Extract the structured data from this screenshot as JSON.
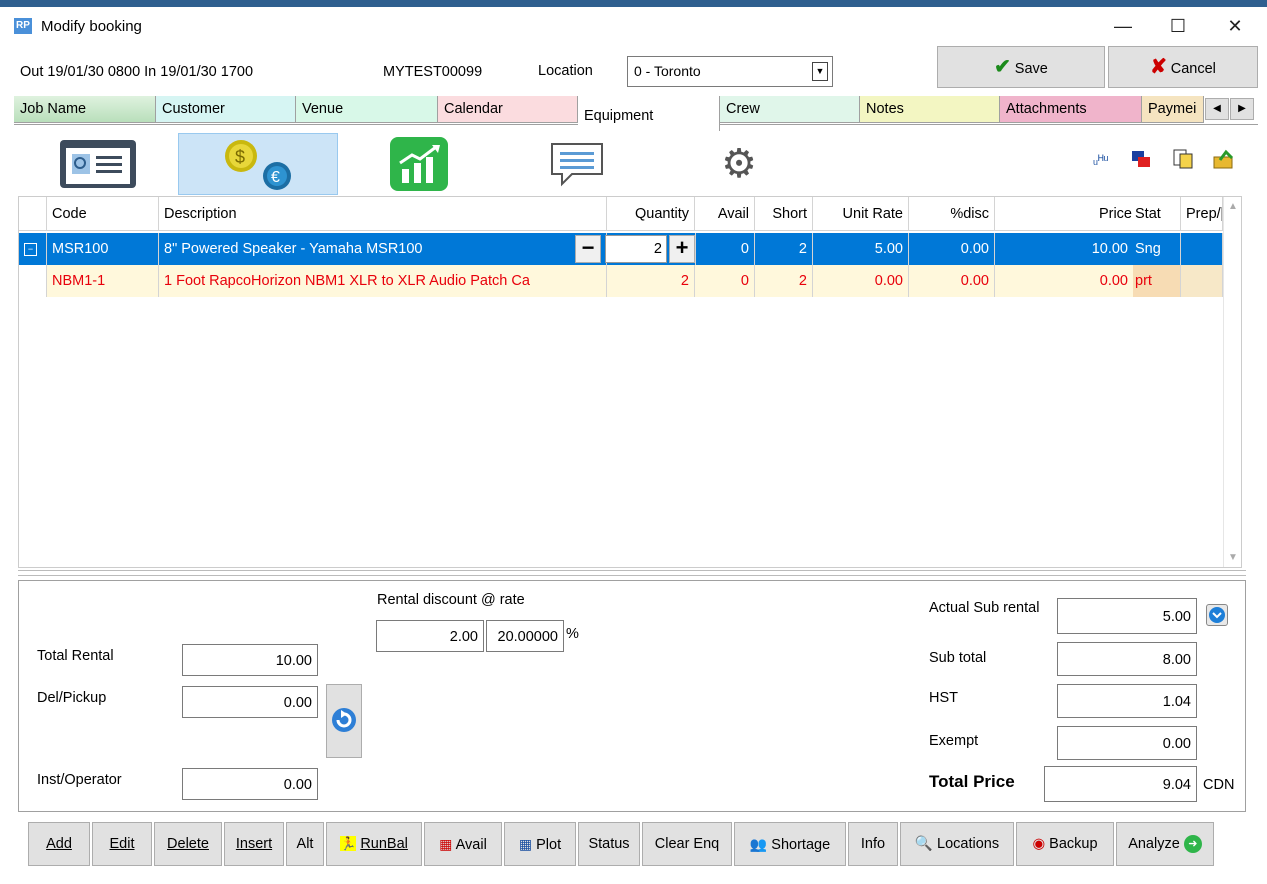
{
  "window": {
    "title": "Modify booking",
    "app_icon": "RP",
    "minimize": "—",
    "maximize": "☐",
    "close": "✕"
  },
  "info": {
    "dates": "Out 19/01/30 0800  In 19/01/30 1700",
    "booking_no": "MYTEST00099",
    "location_label": "Location",
    "location_value": "0 - Toronto",
    "save_label": "Save",
    "cancel_label": "Cancel"
  },
  "tabs": [
    {
      "label": "Job Name",
      "color": "#c8e6c9"
    },
    {
      "label": "Customer",
      "color": "#d6f5f3"
    },
    {
      "label": "Venue",
      "color": "#d8f8e8"
    },
    {
      "label": "Calendar",
      "color": "#fbdcdf"
    },
    {
      "label": "Equipment",
      "color": "#ffffff"
    },
    {
      "label": "Crew",
      "color": "#e0f6ea"
    },
    {
      "label": "Notes",
      "color": "#f3f6c2"
    },
    {
      "label": "Attachments",
      "color": "#f0b4cb"
    },
    {
      "label": "Paymei",
      "color": "#f5e4c0"
    }
  ],
  "grid": {
    "headers": {
      "code": "Code",
      "description": "Description",
      "quantity": "Quantity",
      "avail": "Avail",
      "short": "Short",
      "unit_rate": "Unit Rate",
      "disc": "%disc",
      "price": "Price",
      "stat": "Stat",
      "prep": "Prep/["
    },
    "rows": [
      {
        "code": "MSR100",
        "description": "8\" Powered Speaker - Yamaha MSR100",
        "quantity": "2",
        "avail": "0",
        "short": "2",
        "unit_rate": "5.00",
        "disc": "0.00",
        "price": "10.00",
        "stat": "Sng"
      },
      {
        "code": "NBM1-1",
        "description": "1 Foot RapcoHorizon NBM1 XLR to XLR Audio Patch Ca",
        "quantity": "2",
        "avail": "0",
        "short": "2",
        "unit_rate": "0.00",
        "disc": "0.00",
        "price": "0.00",
        "stat": "prt"
      }
    ]
  },
  "totals": {
    "rental_discount_label": "Rental discount @ rate",
    "rental_discount_amount": "2.00",
    "rental_discount_rate": "20.00000",
    "percent": "%",
    "total_rental_label": "Total Rental",
    "total_rental": "10.00",
    "del_pickup_label": "Del/Pickup",
    "del_pickup": "0.00",
    "inst_operator_label": "Inst/Operator",
    "inst_operator": "0.00",
    "actual_sub_rental_label": "Actual Sub rental",
    "actual_sub_rental": "5.00",
    "sub_total_label": "Sub total",
    "sub_total": "8.00",
    "hst_label": "HST",
    "hst": "1.04",
    "exempt_label": "Exempt",
    "exempt": "0.00",
    "total_price_label": "Total Price",
    "total_price": "9.04",
    "currency": "CDN"
  },
  "buttons": {
    "add": "Add",
    "edit": "Edit",
    "delete": "Delete",
    "insert": "Insert",
    "alt": "Alt",
    "runbal": "RunBal",
    "avail": "Avail",
    "plot": "Plot",
    "status": "Status",
    "clear_enq": "Clear Enq",
    "shortage": "Shortage",
    "info": "Info",
    "locations": "Locations",
    "backup": "Backup",
    "analyze": "Analyze"
  },
  "colors": {
    "selection": "#0078d7",
    "row_alt": "#fff8dc",
    "red_text": "#e8000b"
  }
}
